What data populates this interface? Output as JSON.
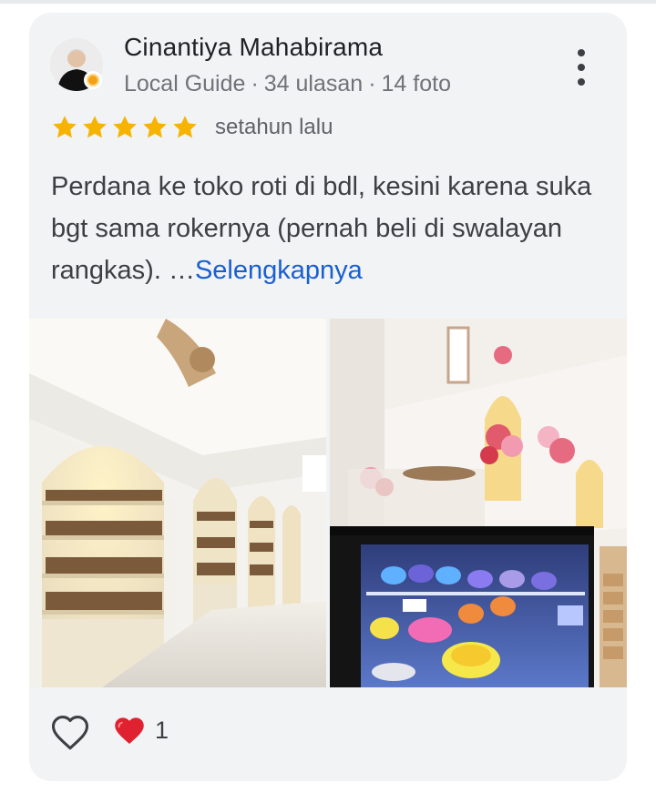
{
  "review": {
    "author_name": "Cinantiya Mahabirama",
    "author_badge": "Local Guide",
    "review_count": "34 ulasan",
    "photo_count": "14 foto",
    "rating": 5,
    "rating_max": 5,
    "time_ago": "setahun lalu",
    "text": "Perdana ke toko roti di bdl, kesini karena suka bgt sama rokernya (pernah beli di swalayan rangkas). …",
    "more_label": "Selengkapnya",
    "reaction_count": "1"
  },
  "icons": {
    "more": "more-vert-icon",
    "star": "star-icon",
    "like": "heart-outline-icon",
    "reaction": "heart-filled-icon"
  },
  "colors": {
    "card_background": "#f1f3f5",
    "star": "#f6b400",
    "link": "#1a5fd1",
    "reaction_heart": "#e0212f",
    "guide_badge": "#f4a11a"
  }
}
